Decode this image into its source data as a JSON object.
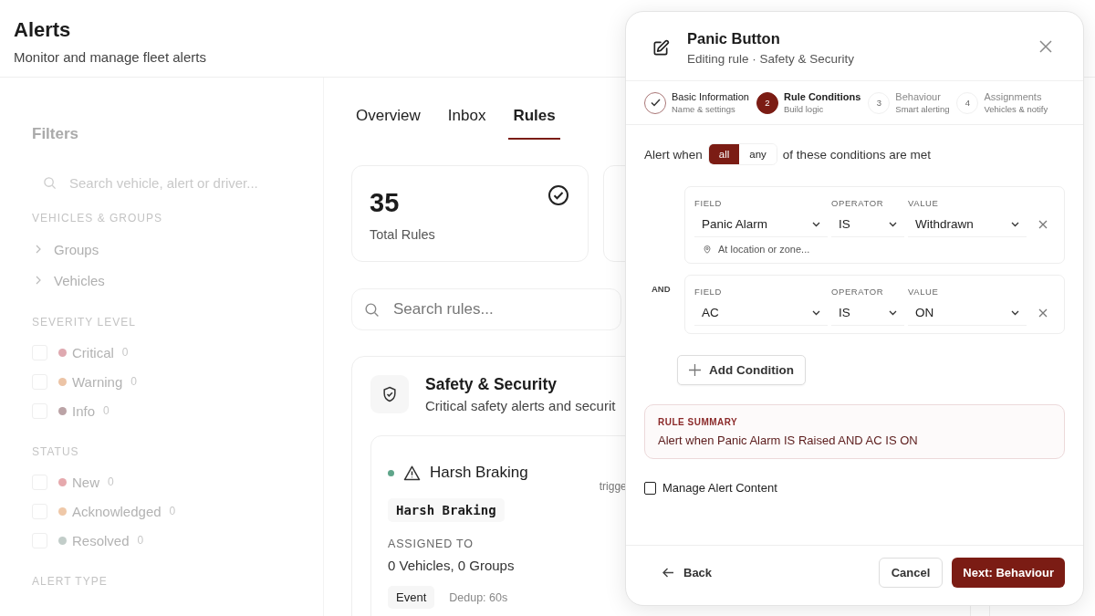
{
  "header": {
    "title": "Alerts",
    "subtitle": "Monitor and manage fleet alerts"
  },
  "filters": {
    "title": "Filters",
    "search": {
      "placeholder": "Search vehicle, alert or driver..."
    },
    "sections": [
      {
        "title": "VEHICLES & GROUPS",
        "kind": "tree",
        "items": [
          {
            "label": "Groups",
            "expanded": false
          },
          {
            "label": "Vehicles",
            "expanded": false
          }
        ]
      },
      {
        "title": "SEVERITY LEVEL",
        "kind": "checks",
        "items": [
          {
            "label": "Critical",
            "count": "0",
            "checked": false,
            "color": "#dfa9b0"
          },
          {
            "label": "Warning",
            "count": "0",
            "checked": false,
            "color": "#ecc4a6"
          },
          {
            "label": "Info",
            "count": "0",
            "checked": false,
            "color": "#bba3a6"
          }
        ]
      },
      {
        "title": "STATUS",
        "kind": "checks",
        "items": [
          {
            "label": "New",
            "count": "0",
            "checked": false,
            "color": "#e6a9ad"
          },
          {
            "label": "Acknowledged",
            "count": "0",
            "checked": false,
            "color": "#efc8a8"
          },
          {
            "label": "Resolved",
            "count": "0",
            "checked": false,
            "color": "#c2cdc9"
          }
        ]
      },
      {
        "title": "ALERT TYPE"
      }
    ]
  },
  "tabs": [
    {
      "label": "Overview",
      "selected": false
    },
    {
      "label": "Inbox",
      "selected": false
    },
    {
      "label": "Rules",
      "selected": true
    }
  ],
  "stats": [
    {
      "value": "35",
      "label": "Total Rules"
    }
  ],
  "rule_search": {
    "placeholder": "Search rules..."
  },
  "category": {
    "title": "Safety & Security",
    "subtitle": "Critical safety alerts and securit",
    "rule": {
      "name": "Harsh Braking",
      "active": true,
      "trigger_label": "trigge",
      "code": "Harsh Braking",
      "assigned_label": "ASSIGNED TO",
      "assigned": "0 Vehicles, 0 Groups",
      "type": "Event",
      "dedup": "Dedup: 60s"
    }
  },
  "drawer": {
    "title": "Panic Button",
    "subtitle": "Editing rule · Safety & Security",
    "steps": [
      {
        "title": "Basic Information",
        "subtitle": "Name & settings",
        "completed": true,
        "selected": false
      },
      {
        "number": "2",
        "title": "Rule Conditions",
        "subtitle": "Build logic",
        "completed": false,
        "selected": true
      },
      {
        "number": "3",
        "title": "Behaviour",
        "subtitle": "Smart alerting",
        "completed": false,
        "selected": false
      },
      {
        "number": "4",
        "title": "Assignments",
        "subtitle": "Vehicles & notify",
        "completed": false,
        "selected": false
      }
    ],
    "match": {
      "prefix": "Alert when",
      "suffix": "of these conditions are met",
      "options": [
        {
          "label": "all",
          "selected": true
        },
        {
          "label": "any",
          "selected": false
        }
      ]
    },
    "conditions": [
      {
        "field_label": "FIELD",
        "operator_label": "OPERATOR",
        "value_label": "VALUE",
        "field": "Panic Alarm",
        "operator": "IS",
        "value": "Withdrawn",
        "location_placeholder": "At location or zone..."
      },
      {
        "connector": "AND",
        "field_label": "FIELD",
        "operator_label": "OPERATOR",
        "value_label": "VALUE",
        "field": "AC",
        "operator": "IS",
        "value": "ON"
      }
    ],
    "add_condition": "Add Condition",
    "summary": {
      "title": "RULE SUMMARY",
      "text": "Alert when Panic Alarm IS Raised AND AC IS ON"
    },
    "manage_content": {
      "label": "Manage Alert Content",
      "checked": false
    },
    "buttons": {
      "back": "Back",
      "cancel": "Cancel",
      "next": "Next: Behaviour"
    }
  }
}
